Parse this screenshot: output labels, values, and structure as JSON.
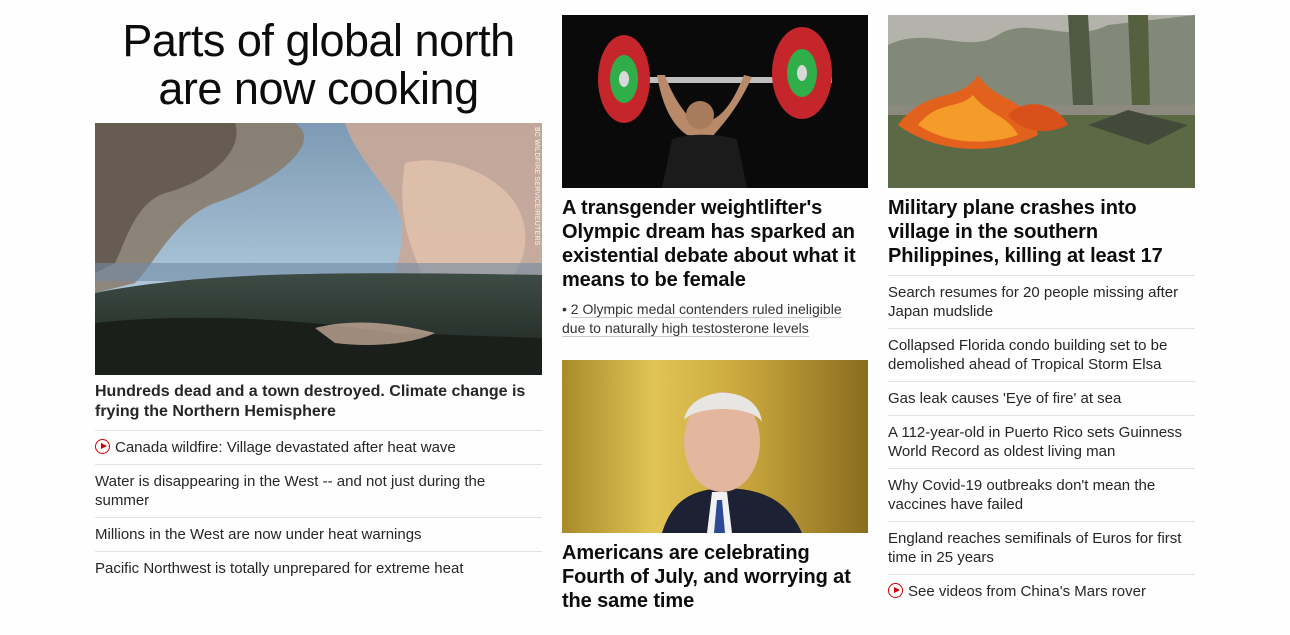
{
  "col1": {
    "banner": "Parts of global north are now cooking",
    "photo_credit": "BC WILDFIRE SERVICE/REUTERS",
    "headline": "Hundreds dead and a town destroyed. Climate change is frying the Northern Hemisphere",
    "links": [
      {
        "text": "Canada wildfire: Village devastated after heat wave",
        "video": true
      },
      {
        "text": "Water is disappearing in the West -- and not just during the summer",
        "video": false
      },
      {
        "text": "Millions in the West are now under heat warnings",
        "video": false
      },
      {
        "text": "Pacific Northwest is totally unprepared for extreme heat",
        "video": false
      }
    ]
  },
  "col2": {
    "story1": {
      "headline": "A transgender weightlifter's Olympic dream has sparked an existential debate about what it means to be female",
      "sub_bullet": "•",
      "sub_link": "2 Olympic medal contenders ruled ineligible due to naturally high testosterone levels"
    },
    "story2": {
      "headline": "Americans are celebrating Fourth of July, and worrying at the same time"
    }
  },
  "col3": {
    "headline": "Military plane crashes into village in the southern Philippines, killing at least 17",
    "links": [
      {
        "text": "Search resumes for 20 people missing after Japan mudslide",
        "video": false
      },
      {
        "text": "Collapsed Florida condo building set to be demolished ahead of Tropical Storm Elsa",
        "video": false
      },
      {
        "text": "Gas leak causes 'Eye of fire' at sea",
        "video": false
      },
      {
        "text": "A 112-year-old in Puerto Rico sets Guinness World Record as oldest living man",
        "video": false
      },
      {
        "text": "Why Covid-19 outbreaks don't mean the vaccines have failed",
        "video": false
      },
      {
        "text": "England reaches semifinals of Euros for first time in 25 years",
        "video": false
      },
      {
        "text": "See videos from China's Mars rover",
        "video": true
      }
    ]
  },
  "colors": {
    "accent_red": "#cc0000",
    "text": "#0c0c0c",
    "divider": "#e1e1e1"
  }
}
